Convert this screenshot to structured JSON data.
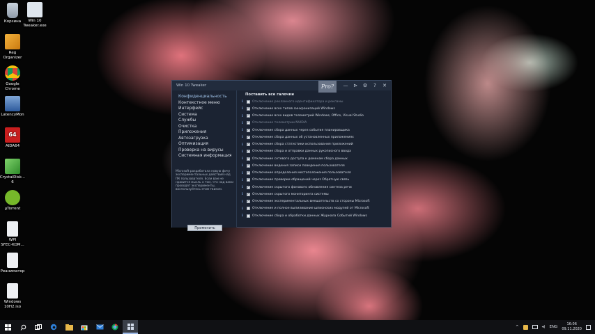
{
  "desktop": {
    "icons": [
      {
        "label": "Корзина",
        "icon": "recycle-bin-icon"
      },
      {
        "label": "Win 10\nTweaker.exe",
        "icon": "win10-tweaker-icon"
      },
      {
        "label": "Reg\nOrganizer",
        "icon": "reg-organizer-icon"
      },
      {
        "label": "Google\nChrome",
        "icon": "chrome-icon"
      },
      {
        "label": "LatencyMon",
        "icon": "latencymon-icon"
      },
      {
        "label": "AIDA64",
        "icon": "aida64-icon"
      },
      {
        "label": "CrystalDisk...\n6",
        "icon": "crystaldisk-icon"
      },
      {
        "label": "µTorrent",
        "icon": "utorrent-icon"
      },
      {
        "label": "WPI\nSFEC-KOM...",
        "icon": "wpi-icon"
      },
      {
        "label": "Реаниматор",
        "icon": "reanimator-icon"
      },
      {
        "label": "Windows\n10H2.iso",
        "icon": "iso-file-icon"
      }
    ]
  },
  "window": {
    "title": "Win 10 Tweaker",
    "pro_badge": "Pro?",
    "controls": [
      "—",
      "⊳",
      "⚙",
      "?",
      "✕"
    ],
    "sidebar": {
      "items": [
        {
          "label": "Конфиденциальность",
          "active": true
        },
        {
          "label": "Контекстное меню",
          "active": false
        },
        {
          "label": "Интерфейс",
          "active": false
        },
        {
          "label": "Система",
          "active": false
        },
        {
          "label": "Службы",
          "active": false
        },
        {
          "label": "Очистка",
          "active": false
        },
        {
          "label": "Приложения",
          "active": false
        },
        {
          "label": "Автозагрузка",
          "active": false
        },
        {
          "label": "Оптимизация",
          "active": false
        },
        {
          "label": "Проверка на вирусы",
          "active": false
        },
        {
          "label": "Системная информация",
          "active": false
        }
      ],
      "note": "Microsoft разработала новую фичу экспериментальных действий над ПК пользователя. Если вам не нравится мысль о том, что над вами проводят эксперименты, воспользуйтесь этим твиком.",
      "apply_label": "Применить"
    },
    "content": {
      "select_all_label": "Поставить все галочки",
      "options": [
        {
          "label": "Отключение рекламного идентификатора и рекламы",
          "checked": false
        },
        {
          "label": "Отключение всех типов синхронизаций Windows",
          "checked": true
        },
        {
          "label": "Отключение всех видов телеметрий Windows, Office, Visual Studio",
          "checked": true
        },
        {
          "label": "Отключение телеметрии NVIDIA",
          "checked": true
        },
        {
          "label": "Отключение сбора данных через события планировщика",
          "checked": true
        },
        {
          "label": "Отключение сбора данных об установленных приложениях",
          "checked": true
        },
        {
          "label": "Отключение сбора статистики использования приложений",
          "checked": true
        },
        {
          "label": "Отключение сбора и отправки данных рукописного ввода",
          "checked": true
        },
        {
          "label": "Отключение сетевого доступа к доменам сбора данных",
          "checked": true
        },
        {
          "label": "Отключение ведения записи поведения пользователя",
          "checked": true
        },
        {
          "label": "Отключение определения местоположения пользователя",
          "checked": true
        },
        {
          "label": "Отключение проверки обращений через Обратную связь",
          "checked": true
        },
        {
          "label": "Отключение скрытого фонового обновления синтеза речи",
          "checked": true
        },
        {
          "label": "Отключение скрытого мониторинга системы",
          "checked": true
        },
        {
          "label": "Отключение экспериментальных вмешательств со стороны Microsoft",
          "checked": true
        },
        {
          "label": "Отключение и полное выпиливание шпионских модулей от Microsoft",
          "checked": false
        },
        {
          "label": "Отключение сбора и обработки данных Журнала Событий Windows",
          "checked": false
        }
      ]
    }
  },
  "taskbar": {
    "items": [
      "windows-start-icon",
      "search-icon",
      "task-view-icon",
      "edge-icon",
      "file-explorer-icon",
      "store-icon",
      "mail-icon",
      "chrome-icon",
      "win10-tweaker-icon"
    ],
    "tray": {
      "lang": "ENG",
      "time": "16:06",
      "date": "09.11.2020"
    }
  }
}
